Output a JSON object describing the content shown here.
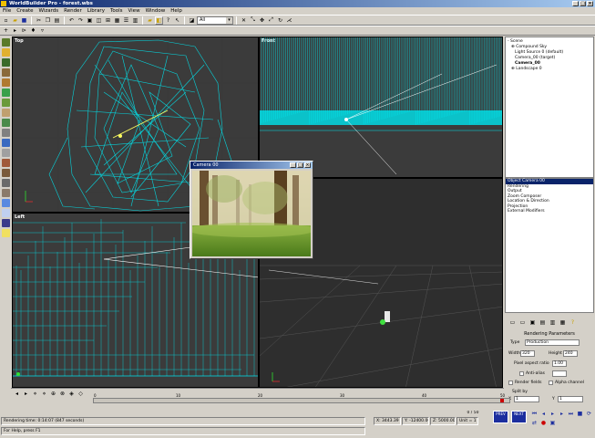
{
  "window": {
    "title": "WorldBuilder Pro - forest.wbs",
    "min": "_",
    "max": "□",
    "close": "×"
  },
  "menu": [
    "File",
    "Create",
    "Wizards",
    "Render",
    "Library",
    "Tools",
    "View",
    "Window",
    "Help"
  ],
  "toolbar": {
    "layer_value": "All"
  },
  "viewports": {
    "top": "Top",
    "front": "Front",
    "left": "Left",
    "perspective": ""
  },
  "camera_window": {
    "title": "Camera 00"
  },
  "scene_tree": [
    "- Scene",
    "  ⊕ Compound Sky",
    "    Light Source 0 (default)",
    "    Camera_00 (target)",
    "    Camera_00",
    "  ⊕ Landscape 0"
  ],
  "properties": {
    "items": [
      "Object Camera 00",
      "Rendering",
      "Output",
      "Zoom Composer",
      "Location & Direction",
      "Projection",
      "External Modifiers"
    ],
    "selected_index": 0
  },
  "render_params": {
    "title": "Rendering Parameters",
    "type_label": "Type",
    "type_value": "Production",
    "width_label": "Width",
    "width_value": "320",
    "height_label": "Height",
    "height_value": "240",
    "aspect_label": "Pixel aspect ratio",
    "aspect_value": "1.00",
    "antialias_label": "Anti-alias",
    "render_fields_label": "Render fields",
    "alpha_label": "Alpha channel",
    "split_label": "Split by",
    "x_label": "X",
    "x_value": "1",
    "y_label": "Y",
    "y_value": "1"
  },
  "timeline": {
    "ticks": [
      "0",
      "10",
      "20",
      "30",
      "40",
      "50"
    ],
    "frame": "0 / 50"
  },
  "status": {
    "render_time": "Rendering time: 0:14:07 (847 seconds)",
    "help": "For Help, press F1",
    "x": "X: 3443.39",
    "y": "Y: -12400.00",
    "z": "Z: 5000.00",
    "unit": "Unit = 1",
    "btn1": "PREV",
    "btn2": "NEXT"
  },
  "colors": {
    "viewport_bg": "#3b3b3b",
    "wireframe": "#00e5ee",
    "titlebar": "#0a246a"
  }
}
